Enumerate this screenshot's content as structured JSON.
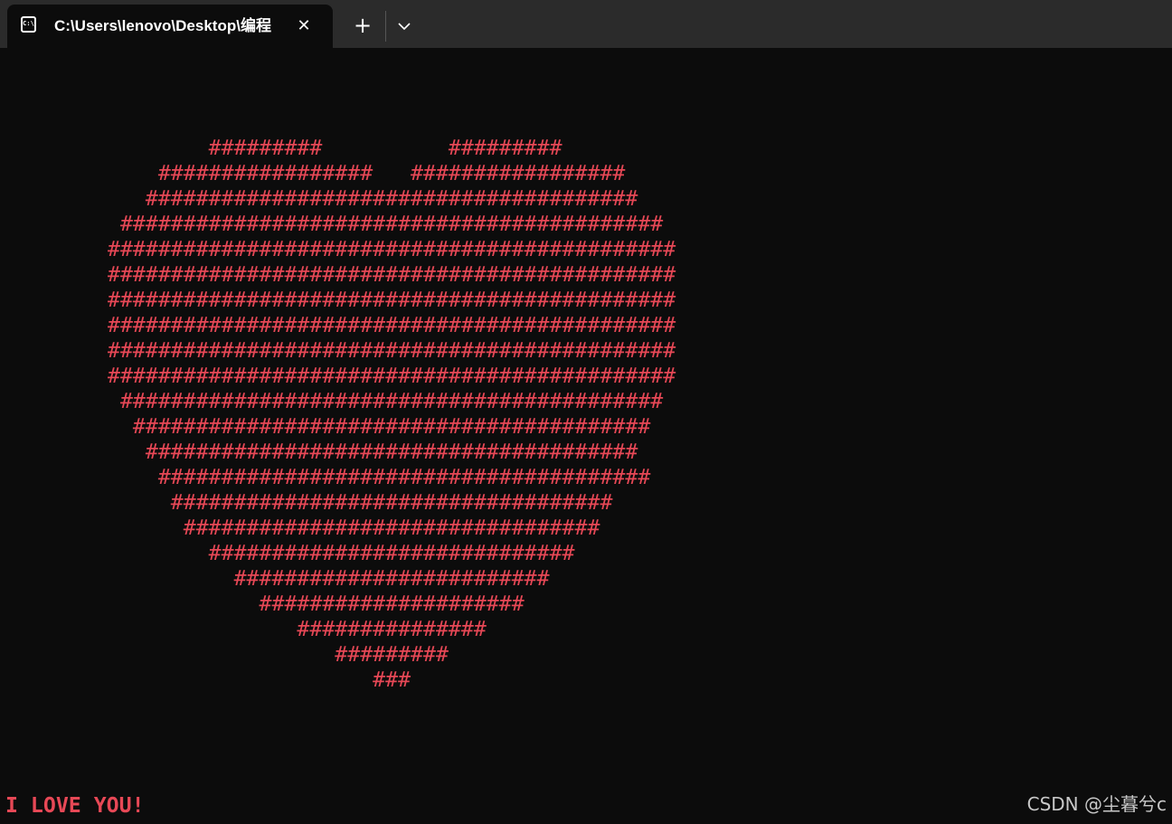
{
  "window": {
    "tab": {
      "icon": "terminal-icon",
      "icon_glyph": "C:\\",
      "title": "C:\\Users\\lenovo\\Desktop\\编程",
      "close_glyph": "✕"
    },
    "new_tab_glyph": "+",
    "dropdown_icon": "chevron-down-icon"
  },
  "terminal": {
    "heart_color": "#e74856",
    "heart_lines": [
      "        #########          #########",
      "    #################   #################",
      "   #######################################",
      " ###########################################",
      "#############################################",
      "#############################################",
      "#############################################",
      "#############################################",
      "#############################################",
      "#############################################",
      " ###########################################",
      "  #########################################",
      "   #######################################",
      "    #######################################",
      "     ###################################",
      "      #################################",
      "        #############################",
      "          #########################",
      "            #####################",
      "               ###############",
      "                  #########",
      "                     ###"
    ],
    "message": "I LOVE YOU!"
  },
  "watermark": "CSDN @尘暮兮c"
}
